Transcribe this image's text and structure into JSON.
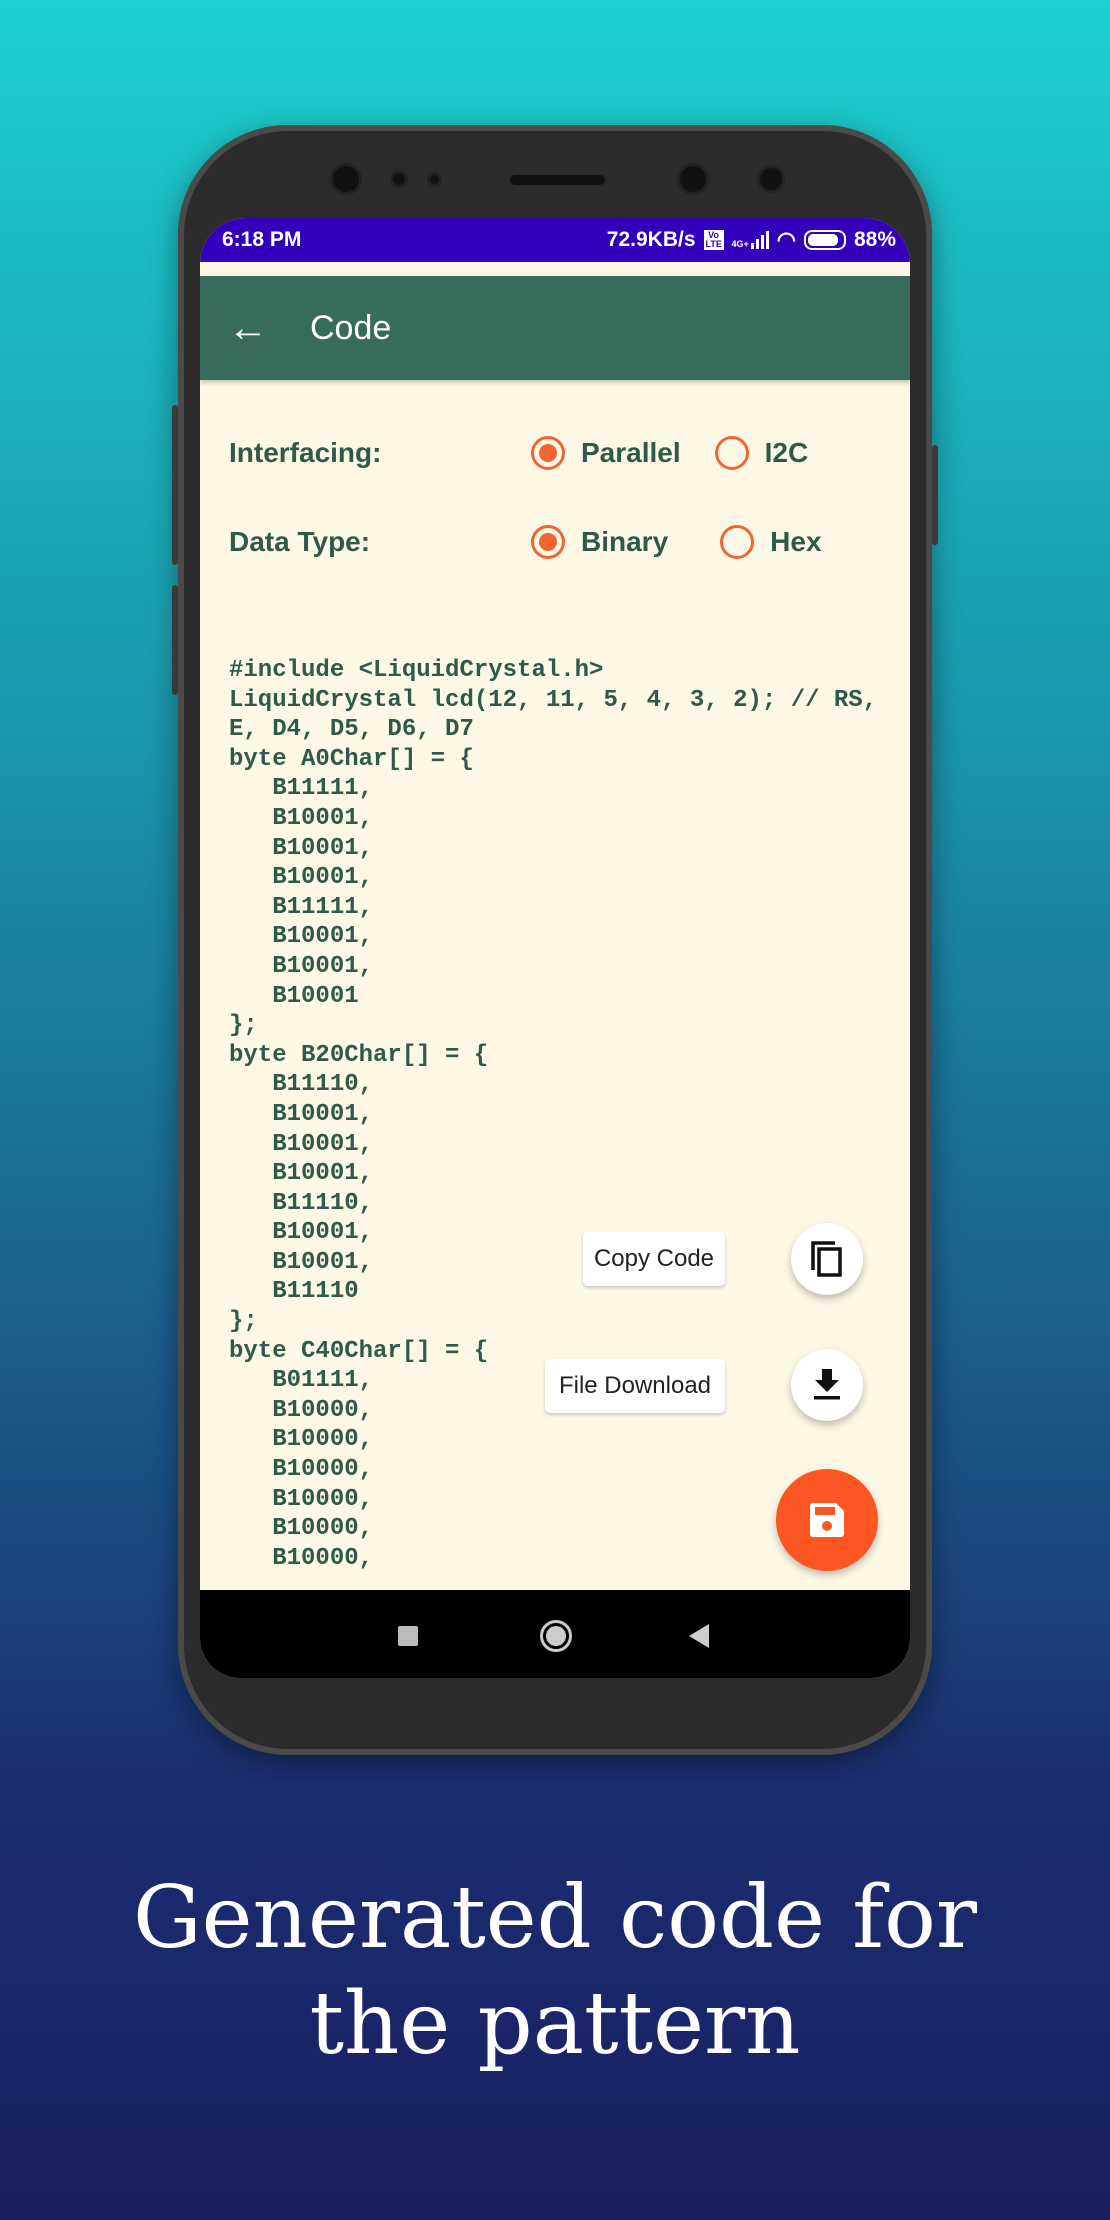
{
  "status_bar": {
    "time": "6:18 PM",
    "net_speed": "72.9KB/s",
    "volte": "Vo LTE",
    "network": "4G+",
    "battery": "88%"
  },
  "app_bar": {
    "title": "Code",
    "back_icon": "arrow-left-icon"
  },
  "options": {
    "interfacing": {
      "label": "Interfacing:",
      "choices": [
        {
          "label": "Parallel",
          "selected": true
        },
        {
          "label": "I2C",
          "selected": false
        }
      ]
    },
    "data_type": {
      "label": "Data Type:",
      "choices": [
        {
          "label": "Binary",
          "selected": true
        },
        {
          "label": "Hex",
          "selected": false
        }
      ]
    }
  },
  "code": "#include <LiquidCrystal.h>\nLiquidCrystal lcd(12, 11, 5, 4, 3, 2); // RS,\nE, D4, D5, D6, D7\nbyte A0Char[] = {\n   B11111,\n   B10001,\n   B10001,\n   B10001,\n   B11111,\n   B10001,\n   B10001,\n   B10001\n};\nbyte B20Char[] = {\n   B11110,\n   B10001,\n   B10001,\n   B10001,\n   B11110,\n   B10001,\n   B10001,\n   B11110\n};\nbyte C40Char[] = {\n   B01111,\n   B10000,\n   B10000,\n   B10000,\n   B10000,\n   B10000,\n   B10000,",
  "fab_menu": {
    "copy_label": "Copy Code",
    "download_label": "File Download"
  },
  "colors": {
    "status_bar": "#3300bb",
    "app_bar": "#376b5b",
    "background": "#fdf8e6",
    "accent": "#f26532",
    "text": "#2f5a4b"
  },
  "caption": {
    "line1": "Generated code for",
    "line2": "the pattern"
  }
}
